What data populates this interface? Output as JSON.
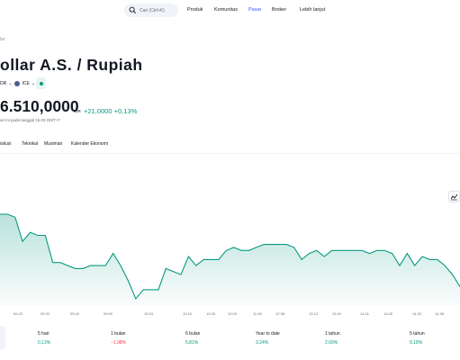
{
  "nav": {
    "search_placeholder": "Cari (Ctrl+K)",
    "links": [
      "Produk",
      "Komunitas",
      "Pasar",
      "Broker",
      "Lebih lanjut"
    ],
    "active": "Pasar"
  },
  "breadcrumb": "lar",
  "title": "ollar A.S. / Rupiah",
  "meta": {
    "symbol": "DR",
    "exchange": "ICE"
  },
  "quote": {
    "price": "6.510,0000",
    "currency": "IDR",
    "change": "+21,0000",
    "change_pct": "+0,13%",
    "as_of": "ari ini pada tanggal 15.03 GMT+7"
  },
  "tabs": [
    "iskusi",
    "Teknikal",
    "Musiman",
    "Kalender Ekonomi"
  ],
  "colors": {
    "accent": "#2962ff",
    "up": "#089981",
    "down": "#f23645"
  },
  "icons": {
    "search": "search-icon",
    "chart": "chart-type-icon",
    "badge": "market-status-icon"
  },
  "chart_data": {
    "type": "area",
    "xlabel": "",
    "ylabel": "",
    "x_ticks": [
      "09.23",
      "09.32",
      "09.42",
      "09.50",
      "10.03",
      "10.10",
      "10.26",
      "10.03",
      "11.26",
      "12.38",
      "13.13",
      "13.42",
      "14.01",
      "14.05",
      "14.25",
      "14.38"
    ],
    "series": [
      {
        "values": [
          16528,
          16528,
          16527,
          16519,
          16522,
          16521,
          16521,
          16512,
          16512,
          16511,
          16510,
          16510,
          16511,
          16511,
          16511,
          16515,
          16511,
          16506,
          16500,
          16503,
          16503,
          16503,
          16510,
          16509,
          16508,
          16514,
          16511,
          16513,
          16513,
          16513,
          16516,
          16517,
          16516,
          16516,
          16517,
          16518,
          16518,
          16518,
          16518,
          16517,
          16513,
          16515,
          16516,
          16514,
          16516,
          16516,
          16516,
          16516,
          16516,
          16515,
          16516,
          16516,
          16515,
          16511,
          16515,
          16511,
          16514,
          16513,
          16513,
          16511,
          16508,
          16504
        ]
      }
    ]
  },
  "performance": [
    {
      "label": "5 hari",
      "value": "0,13%",
      "dir": "up"
    },
    {
      "label": "1 bulan",
      "value": "−1,98%",
      "dir": "down"
    },
    {
      "label": "6 bulan",
      "value": "5,81%",
      "dir": "up"
    },
    {
      "label": "Year to date",
      "value": "3,24%",
      "dir": "up"
    },
    {
      "label": "1 tahun",
      "value": "2,69%",
      "dir": "up"
    },
    {
      "label": "5 tahun",
      "value": "9,18%",
      "dir": "up"
    }
  ]
}
